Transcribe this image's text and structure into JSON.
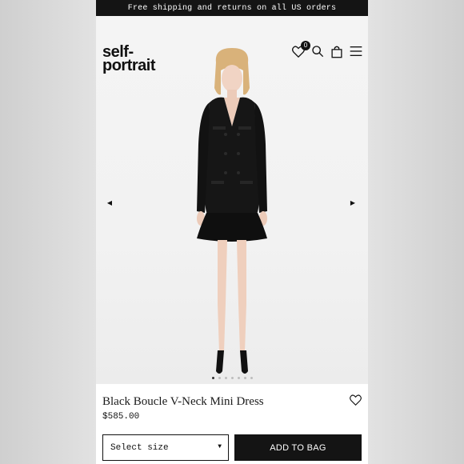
{
  "announcement": "Free shipping and returns on all US orders",
  "header": {
    "logo_line1": "self-",
    "logo_line2": "portrait",
    "wishlist_count": "0",
    "icons": [
      "heart-icon",
      "search-icon",
      "bag-icon",
      "menu-icon"
    ]
  },
  "gallery": {
    "prev_glyph": "◀",
    "next_glyph": "▶",
    "dot_count": 7,
    "active_dot": 0
  },
  "product": {
    "title": "Black Boucle V-Neck Mini Dress",
    "price": "$585.00",
    "size_placeholder": "Select size",
    "add_to_bag_label": "ADD TO BAG"
  },
  "colors": {
    "brand_dark": "#141414",
    "background": "#ffffff"
  }
}
